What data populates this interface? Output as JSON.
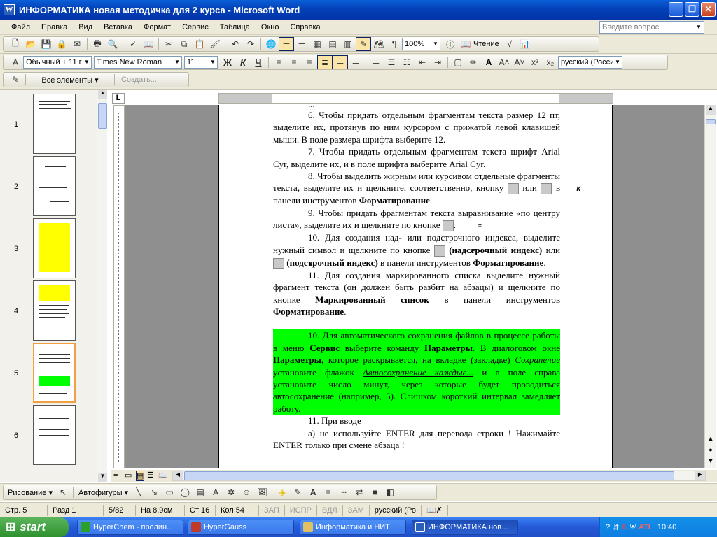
{
  "window": {
    "title": "ИНФОРМАТИКА новая методичка для 2 курса - Microsoft Word"
  },
  "menu": {
    "items": [
      "Файл",
      "Правка",
      "Вид",
      "Вставка",
      "Формат",
      "Сервис",
      "Таблица",
      "Окно",
      "Справка"
    ],
    "ask_placeholder": "Введите вопрос"
  },
  "standard_toolbar": {
    "zoom": "100%",
    "reading_label": "Чтение"
  },
  "format_toolbar": {
    "style": "Обычный + 11 г",
    "font": "Times New Roman",
    "size": "11",
    "bold": "Ж",
    "italic": "К",
    "underline": "Ч",
    "language": "русский (Росси"
  },
  "reviewing_toolbar": {
    "show_label": "Все элементы",
    "create_label": "Создать..."
  },
  "thumbnails": [
    "1",
    "2",
    "3",
    "4",
    "5",
    "6"
  ],
  "document": {
    "top_fragment": "...",
    "p6": "6. Чтобы придать отдельным фрагментам текста размер 12 пт, выделите их, протянув по ним курсором с прижатой левой клавишей мыши. В поле размера шрифта выберите 12.",
    "p7": "7. Чтобы придать отдельным фрагментам текста шрифт Arial Cyr, выделите их, и в поле шрифта выберите Arial Cyr.",
    "p8a": "8. Чтобы выделить жирным или курсивом отдельные фрагменты текста, выделите их и щелкните, соответственно, кнопку",
    "p8b": "или",
    "p8c": "в панели инструментов",
    "p8d": "Форматирование",
    "p9a": "9. Чтобы придать фрагментам текста выравнивание «по центру листа», выделите их и щелкните по кнопке",
    "p10a": "10. Для создания над- или подстрочного индекса, выделите нужный символ и щелкните по кнопке",
    "p10b": "(надстрочный индекс)",
    "p10c": "или",
    "p10d": "(подстрочный индекс)",
    "p10e": "в панели инструментов",
    "p10f": "Форматирование",
    "p11a": "11. Для создания маркированного списка выделите нужный фрагмент текста (он должен быть разбит на абзацы) и щелкните по кнопке",
    "p11b": "Маркированный список",
    "p11c": "в панели инструментов",
    "p11d": "Форматирование",
    "g1": "10.      Для автоматического сохранения файлов в процессе работы в меню",
    "g2": "Сервис",
    "g3": "выберите команду",
    "g4": "Параметры",
    "g5": ". В диалоговом окне",
    "g6": "Параметры",
    "g7": ", которое раскрывается, на вкладке (закладке)",
    "g8": "Сохранение",
    "g9": "установите флажок",
    "g10": "Автосохранение каждые...",
    "g11": "и в поле справа установите число минут, через которые будет проводиться автосохранение (например, 5). Слишком короткий интервал замедляет работу.",
    "p_last1": "11.        При вводе",
    "p_last2": "а) не используйте ENTER для перевода строки ! Нажимайте ENTER только при смене абзаца !"
  },
  "drawing_toolbar": {
    "draw_label": "Рисование",
    "autoshapes_label": "Автофигуры"
  },
  "status": {
    "page": "Стр. 5",
    "section": "Разд 1",
    "pages": "5/82",
    "at": "На 8.9см",
    "line": "Ст 16",
    "col": "Кол 54",
    "rec": "ЗАП",
    "trk": "ИСПР",
    "ext": "ВДЛ",
    "ovr": "ЗАМ",
    "lang": "русский (Ро"
  },
  "taskbar": {
    "start": "start",
    "tasks": [
      "HyperChem - пролин...",
      "HyperGauss",
      "Информатика и НИТ",
      "ИНФОРМАТИКА нов..."
    ],
    "lang": "RU",
    "clock": "10:40"
  },
  "colors": {
    "highlight": "#00ff00",
    "titlebar": "#0441b8"
  }
}
